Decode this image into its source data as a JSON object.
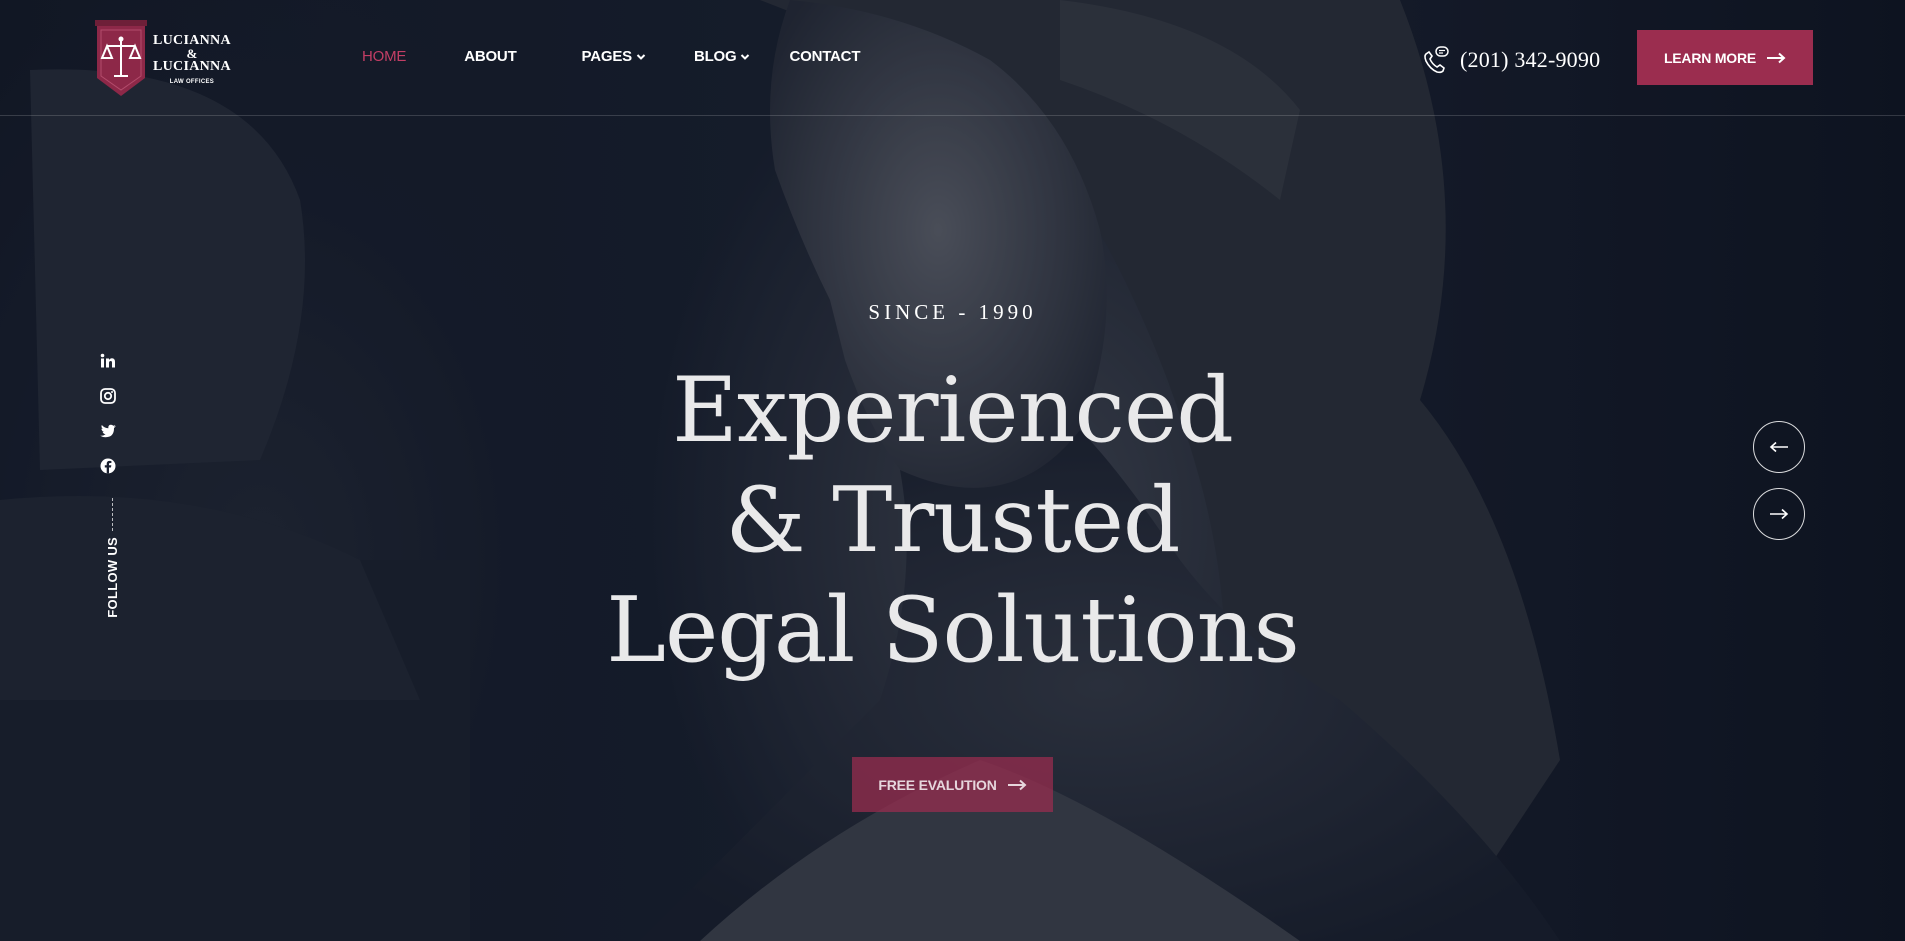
{
  "brand": {
    "name_line1": "LUCIANNA",
    "ampersand": "&",
    "name_line2": "LUCIANNA",
    "subtitle": "LAW OFFICES",
    "accent_color": "#9b2d4f"
  },
  "nav": {
    "items": [
      {
        "label": "HOME",
        "active": true
      },
      {
        "label": "ABOUT"
      },
      {
        "label": "PAGES",
        "dropdown": true
      },
      {
        "label": "BLOG",
        "dropdown": true
      },
      {
        "label": "CONTACT"
      }
    ]
  },
  "header": {
    "phone": "(201) 342-9090",
    "phone_icon": "phone-chat-icon",
    "cta_label": "LEARN MORE"
  },
  "social": {
    "icons": [
      "linkedin-icon",
      "instagram-icon",
      "twitter-icon",
      "facebook-icon"
    ],
    "follow_label": "FOLLOW US"
  },
  "hero": {
    "eyebrow": "SINCE - 1990",
    "headline_lines": [
      "Experienced",
      "& Trusted",
      "Legal Solutions"
    ],
    "cta_label": "FREE EVALUTION"
  },
  "slider": {
    "prev_icon": "arrow-left-icon",
    "next_icon": "arrow-right-icon"
  }
}
